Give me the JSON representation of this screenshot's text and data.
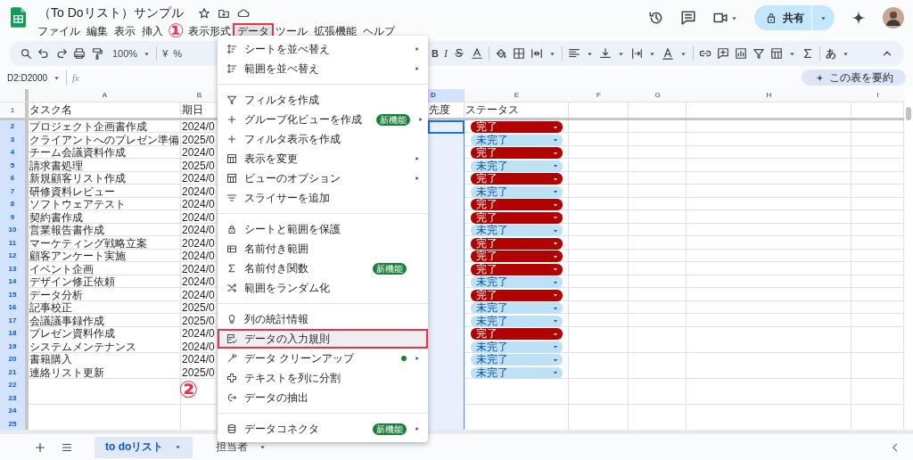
{
  "app": {
    "title": "（To Doリスト）サンプル"
  },
  "menubar": [
    {
      "label": "ファイル",
      "selected": false
    },
    {
      "label": "編集",
      "selected": false
    },
    {
      "label": "表示",
      "selected": false
    },
    {
      "label": "挿入",
      "selected": false
    },
    {
      "label": "表示形式",
      "selected": false
    },
    {
      "label": "データ",
      "selected": true
    },
    {
      "label": "ツール",
      "selected": false
    },
    {
      "label": "拡張機能",
      "selected": false
    },
    {
      "label": "ヘルプ",
      "selected": false
    }
  ],
  "share_button": {
    "label": "共有"
  },
  "toolbar": {
    "zoom": "100%",
    "currency": "¥",
    "percent": "%",
    "bold": "B",
    "italic": "I",
    "input_tool": "あ"
  },
  "formula_bar": {
    "name_box": "D2:D2000",
    "fx": "fx"
  },
  "summarize_button": {
    "label": "この表を要約"
  },
  "columns": [
    {
      "label": "A",
      "selected": false
    },
    {
      "label": "B",
      "selected": false
    },
    {
      "label": "D",
      "selected": true
    },
    {
      "label": "E",
      "selected": false
    },
    {
      "label": "F",
      "selected": false
    },
    {
      "label": "G",
      "selected": false
    },
    {
      "label": "H",
      "selected": false
    },
    {
      "label": "I",
      "selected": false
    }
  ],
  "header_row": {
    "num": "1",
    "task": "タスク名",
    "date": "期日",
    "priority": "先度",
    "status": "ステータス"
  },
  "rows": [
    {
      "num": "2",
      "selected": true,
      "task": "プロジェクト企画書作成",
      "date": "2024/0",
      "status": "完了",
      "done": true
    },
    {
      "num": "3",
      "selected": true,
      "task": "クライアントへのプレゼン準備",
      "date": "2025/0",
      "status": "未完了",
      "done": false
    },
    {
      "num": "4",
      "selected": true,
      "task": "チーム会議資料作成",
      "date": "2024/0",
      "status": "完了",
      "done": true
    },
    {
      "num": "5",
      "selected": true,
      "task": "請求書処理",
      "date": "2025/0",
      "status": "未完了",
      "done": false
    },
    {
      "num": "6",
      "selected": true,
      "task": "新規顧客リスト作成",
      "date": "2024/0",
      "status": "完了",
      "done": true
    },
    {
      "num": "7",
      "selected": true,
      "task": "研修資料レビュー",
      "date": "2024/0",
      "status": "未完了",
      "done": false
    },
    {
      "num": "8",
      "selected": true,
      "task": "ソフトウェアテスト",
      "date": "2024/0",
      "status": "完了",
      "done": true
    },
    {
      "num": "9",
      "selected": true,
      "task": "契約書作成",
      "date": "2024/0",
      "status": "完了",
      "done": true
    },
    {
      "num": "10",
      "selected": true,
      "task": "営業報告書作成",
      "date": "2024/0",
      "status": "未完了",
      "done": false
    },
    {
      "num": "11",
      "selected": true,
      "task": "マーケティング戦略立案",
      "date": "2024/0",
      "status": "完了",
      "done": true
    },
    {
      "num": "12",
      "selected": true,
      "task": "顧客アンケート実施",
      "date": "2024/0",
      "status": "完了",
      "done": true
    },
    {
      "num": "13",
      "selected": true,
      "task": "イベント企画",
      "date": "2024/0",
      "status": "完了",
      "done": true
    },
    {
      "num": "14",
      "selected": true,
      "task": "デザイン修正依頼",
      "date": "2024/0",
      "status": "未完了",
      "done": false
    },
    {
      "num": "15",
      "selected": true,
      "task": "データ分析",
      "date": "2024/0",
      "status": "完了",
      "done": true
    },
    {
      "num": "16",
      "selected": true,
      "task": "記事校正",
      "date": "2025/0",
      "status": "未完了",
      "done": false
    },
    {
      "num": "17",
      "selected": true,
      "task": "会議議事録作成",
      "date": "2025/0",
      "status": "未完了",
      "done": false
    },
    {
      "num": "18",
      "selected": true,
      "task": "プレゼン資料作成",
      "date": "2024/0",
      "status": "完了",
      "done": true
    },
    {
      "num": "19",
      "selected": true,
      "task": "システムメンテナンス",
      "date": "2024/0",
      "status": "未完了",
      "done": false
    },
    {
      "num": "20",
      "selected": true,
      "task": "書籍購入",
      "date": "2024/0",
      "status": "未完了",
      "done": false
    },
    {
      "num": "21",
      "selected": true,
      "task": "連絡リスト更新",
      "date": "2025/0",
      "status": "未完了",
      "done": false
    },
    {
      "num": "22",
      "selected": true
    },
    {
      "num": "23",
      "selected": true
    },
    {
      "num": "24",
      "selected": true
    },
    {
      "num": "25",
      "selected": true
    }
  ],
  "data_menu": [
    {
      "kind": "item",
      "label": "シートを並べ替え",
      "submenu": true,
      "highlighted": false,
      "dot": false
    },
    {
      "kind": "item",
      "label": "範囲を並べ替え",
      "submenu": true,
      "highlighted": false,
      "dot": false
    },
    {
      "kind": "separator"
    },
    {
      "kind": "item",
      "label": "フィルタを作成",
      "submenu": false,
      "highlighted": false,
      "dot": false
    },
    {
      "kind": "item",
      "label": "グループ化ビューを作成",
      "badge": "新機能",
      "submenu": true,
      "highlighted": false,
      "dot": false
    },
    {
      "kind": "item",
      "label": "フィルタ表示を作成",
      "submenu": false,
      "highlighted": false,
      "dot": false
    },
    {
      "kind": "item",
      "label": "表示を変更",
      "submenu": true,
      "highlighted": false,
      "dot": false
    },
    {
      "kind": "item",
      "label": "ビューのオプション",
      "submenu": true,
      "highlighted": false,
      "dot": false
    },
    {
      "kind": "item",
      "label": "スライサーを追加",
      "submenu": false,
      "highlighted": false,
      "dot": false
    },
    {
      "kind": "separator"
    },
    {
      "kind": "item",
      "label": "シートと範囲を保護",
      "submenu": false,
      "highlighted": false,
      "dot": false
    },
    {
      "kind": "item",
      "label": "名前付き範囲",
      "submenu": false,
      "highlighted": false,
      "dot": false
    },
    {
      "kind": "item",
      "label": "名前付き関数",
      "badge": "新機能",
      "submenu": false,
      "highlighted": false,
      "dot": false
    },
    {
      "kind": "item",
      "label": "範囲をランダム化",
      "submenu": false,
      "highlighted": false,
      "dot": false
    },
    {
      "kind": "separator"
    },
    {
      "kind": "item",
      "label": "列の統計情報",
      "submenu": false,
      "highlighted": false,
      "dot": false
    },
    {
      "kind": "item",
      "label": "データの入力規則",
      "submenu": false,
      "highlighted": true,
      "dot": false
    },
    {
      "kind": "item",
      "label": "データ クリーンアップ",
      "submenu": true,
      "highlighted": false,
      "dot": true
    },
    {
      "kind": "item",
      "label": "テキストを列に分割",
      "submenu": false,
      "highlighted": false,
      "dot": false
    },
    {
      "kind": "item",
      "label": "データの抽出",
      "submenu": false,
      "highlighted": false,
      "dot": false
    },
    {
      "kind": "separator"
    },
    {
      "kind": "item",
      "label": "データコネクタ",
      "badge": "新機能",
      "submenu": true,
      "highlighted": false,
      "dot": false
    }
  ],
  "sheet_tabs": [
    {
      "label": "to doリスト",
      "selected": true
    },
    {
      "label": "担当者",
      "selected": false
    }
  ],
  "annotations": [
    {
      "label": "①"
    },
    {
      "label": "②"
    }
  ]
}
